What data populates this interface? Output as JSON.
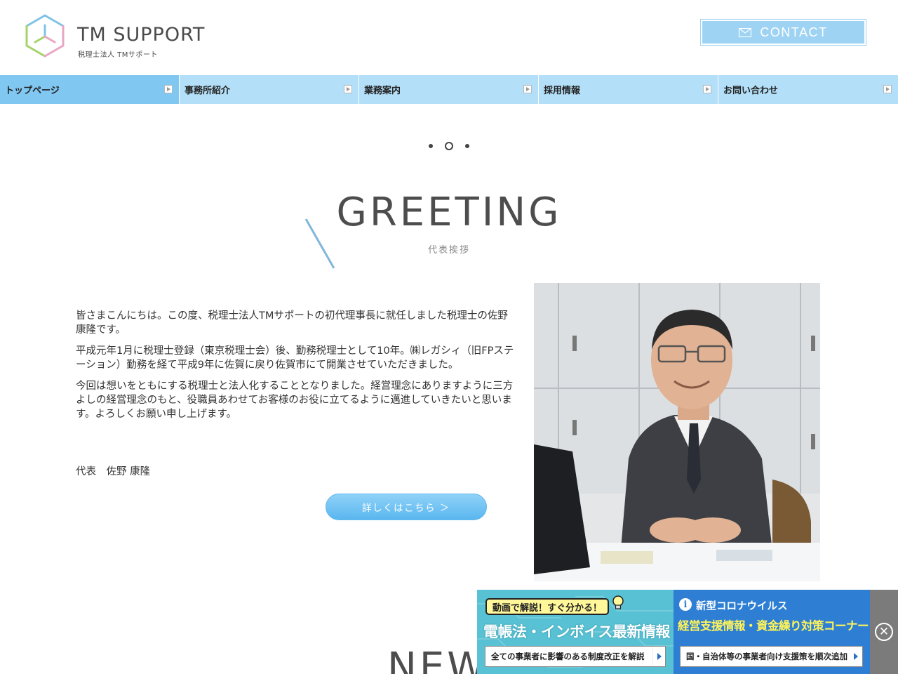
{
  "header": {
    "logo_title": "TM SUPPORT",
    "logo_sub": "税理士法人 TMサポート",
    "contact_label": "CONTACT"
  },
  "nav": {
    "items": [
      {
        "label": "トップページ"
      },
      {
        "label": "事務所紹介"
      },
      {
        "label": "業務案内"
      },
      {
        "label": "採用情報"
      },
      {
        "label": "お問い合わせ"
      }
    ]
  },
  "greeting": {
    "title": "GREETING",
    "subtitle": "代表挨拶",
    "paragraphs": [
      "皆さまこんにちは。この度、税理士法人TMサポートの初代理事長に就任しました税理士の佐野康隆です。",
      "平成元年1月に税理士登録（東京税理士会）後、勤務税理士として10年。㈱レガシィ（旧FPステーション）勤務を経て平成9年に佐賀に戻り佐賀市にて開業させていただきました。",
      "今回は想いをともにする税理士と法人化することとなりました。経営理念にありますように三方よしの経営理念のもと、役職員あわせてお客様のお役に立てるように邁進していきたいと思います。よろしくお願い申し上げます。"
    ],
    "signature": "代表　佐野 康隆",
    "detail_button": "詳しくはこちら ＞"
  },
  "news": {
    "title": "NEWS"
  },
  "banner": {
    "left_tag": "動画で解説！すぐ分かる！",
    "left_headline": "電帳法・インボイス最新情報",
    "left_button": "全ての事業者に影響のある制度改正を解説",
    "right_title": "新型コロナウイルス",
    "right_headline": "経営支援情報・資金繰り対策コーナー",
    "right_button": "国・自治体等の事業者向け支援策を順次追加"
  },
  "colors": {
    "nav_bg": "#b3dff8",
    "nav_active": "#80c7f1",
    "contact_bg": "#9ed3f4",
    "banner_left": "#58c1d3",
    "banner_right": "#2e7fd3"
  }
}
